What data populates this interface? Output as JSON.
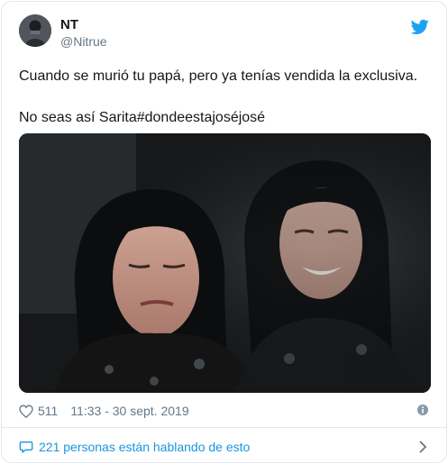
{
  "tweet": {
    "display_name": "NT",
    "handle": "@Nitrue",
    "text_line1": "Cuando se murió tu papá, pero ya tenías vendida la exclusiva.",
    "text_line2": "No seas así Sarita#dondeestajoséjosé",
    "likes": "511",
    "timestamp": "11:33 - 30 sept. 2019",
    "conversation": "221 personas están hablando de esto"
  },
  "icons": {
    "brand": "twitter-bird-icon",
    "like": "heart-icon",
    "info": "info-icon",
    "reply": "speech-bubble-icon",
    "open": "chevron-right-icon"
  },
  "colors": {
    "twitter_blue": "#1da1f2",
    "link_blue": "#1b95e0",
    "secondary_text": "#657786",
    "border": "#e1e8ed"
  }
}
